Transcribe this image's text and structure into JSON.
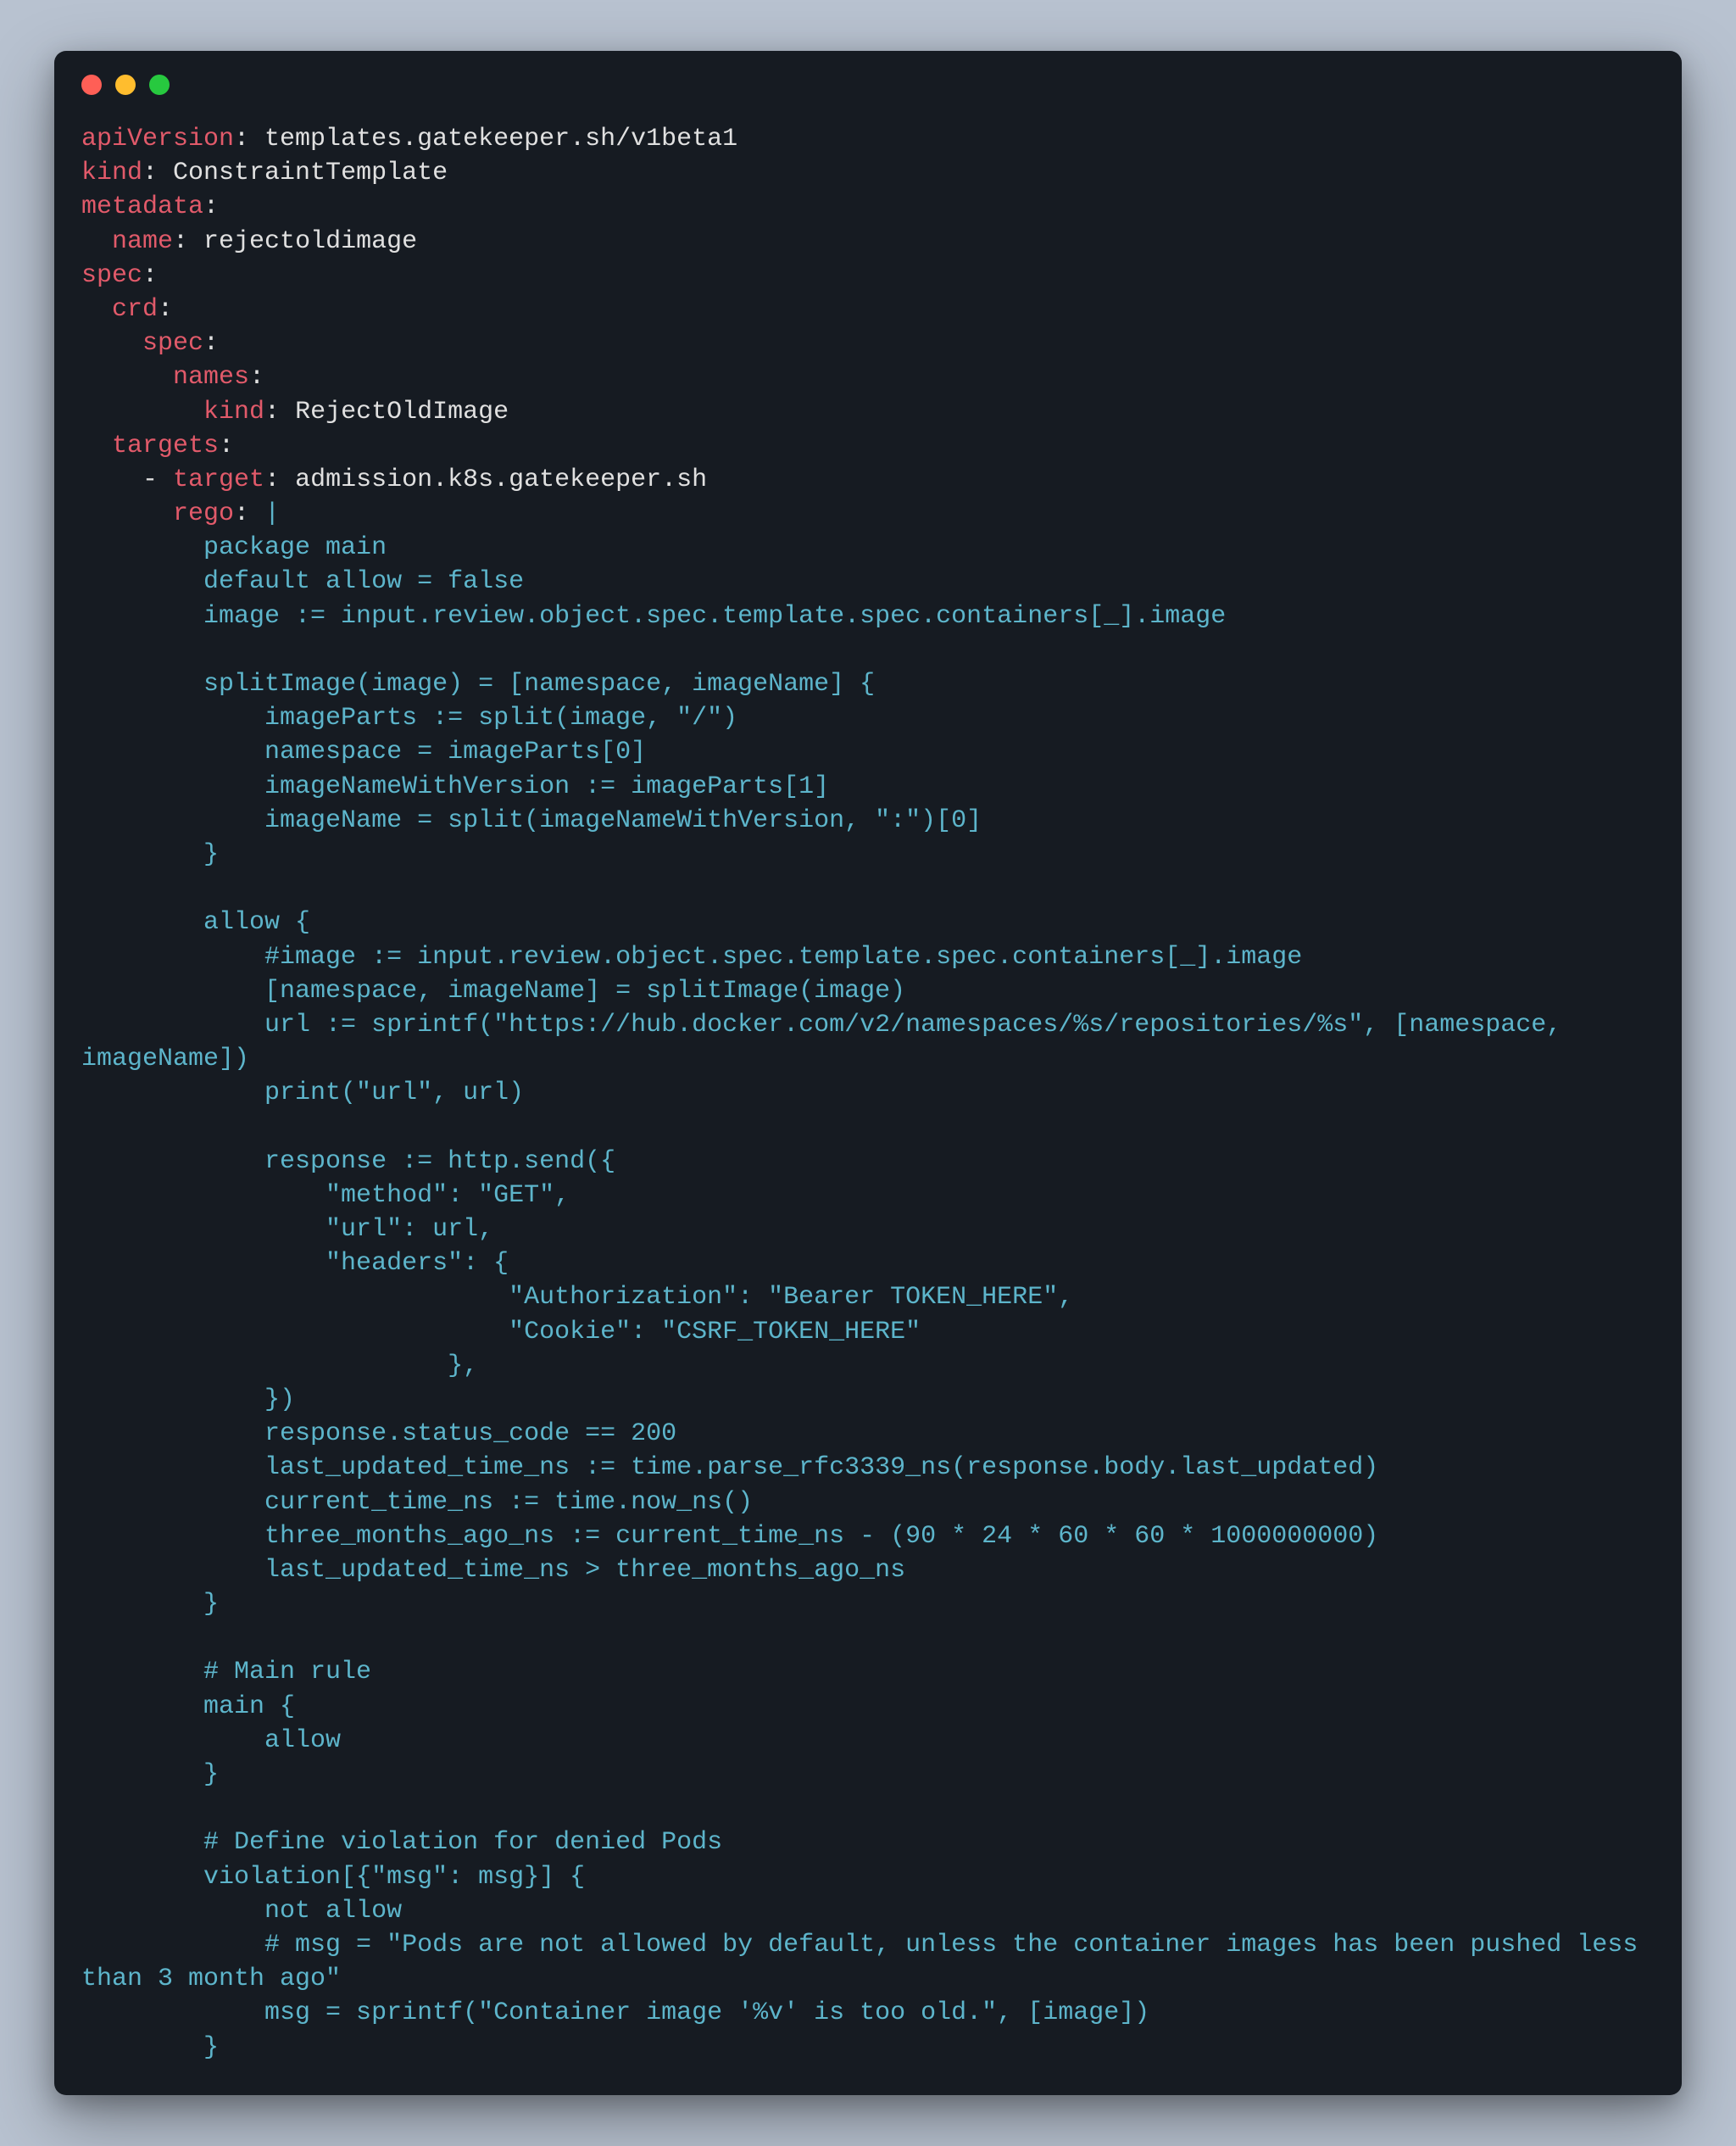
{
  "titlebar": {
    "buttons": [
      "close",
      "minimize",
      "zoom"
    ]
  },
  "yaml": {
    "l01_key": "apiVersion",
    "l01_val": "templates.gatekeeper.sh/v1beta1",
    "l02_key": "kind",
    "l02_val": "ConstraintTemplate",
    "l03_key": "metadata",
    "l04_key": "name",
    "l04_val": "rejectoldimage",
    "l05_key": "spec",
    "l06_key": "crd",
    "l07_key": "spec",
    "l08_key": "names",
    "l09_key": "kind",
    "l09_val": "RejectOldImage",
    "l10_key": "targets",
    "l11_dash": "-",
    "l11_key": "target",
    "l11_val": "admission.k8s.gatekeeper.sh",
    "l12_key": "rego",
    "l12_pipe": "|"
  },
  "rego": {
    "r01": "package main",
    "r02": "default allow = false",
    "r03": "image := input.review.object.spec.template.spec.containers[_].image",
    "r04": "",
    "r05": "splitImage(image) = [namespace, imageName] {",
    "r06": "    imageParts := split(image, \"/\")",
    "r07": "    namespace = imageParts[0]",
    "r08": "    imageNameWithVersion := imageParts[1]",
    "r09": "    imageName = split(imageNameWithVersion, \":\")[0]",
    "r10": "}",
    "r11": "",
    "r12": "allow {",
    "r13": "    #image := input.review.object.spec.template.spec.containers[_].image",
    "r14": "    [namespace, imageName] = splitImage(image)",
    "r15": "    url := sprintf(\"https://hub.docker.com/v2/namespaces/%s/repositories/%s\", [namespace, imageName])",
    "r16": "    print(\"url\", url)",
    "r17": "",
    "r18": "    response := http.send({",
    "r19": "        \"method\": \"GET\",",
    "r20": "        \"url\": url,",
    "r21": "        \"headers\": {",
    "r22": "                    \"Authorization\": \"Bearer TOKEN_HERE\",",
    "r23": "                    \"Cookie\": \"CSRF_TOKEN_HERE\"",
    "r24": "                },",
    "r25": "    })",
    "r26": "    response.status_code == 200",
    "r27": "    last_updated_time_ns := time.parse_rfc3339_ns(response.body.last_updated)",
    "r28": "    current_time_ns := time.now_ns()",
    "r29": "    three_months_ago_ns := current_time_ns - (90 * 24 * 60 * 60 * 1000000000)",
    "r30": "    last_updated_time_ns > three_months_ago_ns",
    "r31": "}",
    "r32": "",
    "r33": "# Main rule",
    "r34": "main {",
    "r35": "    allow",
    "r36": "}",
    "r37": "",
    "r38": "# Define violation for denied Pods",
    "r39": "violation[{\"msg\": msg}] {",
    "r40": "    not allow",
    "r41": "    # msg = \"Pods are not allowed by default, unless the container images has been pushed less than 3 month ago\"",
    "r42": "    msg = sprintf(\"Container image '%v' is too old.\", [image])",
    "r43": "}"
  },
  "indent": {
    "i0": "",
    "i2": "  ",
    "i4": "    ",
    "i6": "      ",
    "i8": "        ",
    "rego_base": "        "
  }
}
